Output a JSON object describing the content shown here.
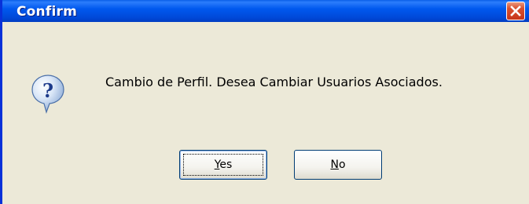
{
  "window": {
    "title": "Confirm"
  },
  "dialog": {
    "icon": "question-icon",
    "message": "Cambio de Perfil. Desea Cambiar Usuarios Asociados."
  },
  "buttons": {
    "yes_accel": "Y",
    "yes_rest": "es",
    "no_accel": "N",
    "no_rest": "o"
  },
  "colors": {
    "titlebar": "#0058ee",
    "close": "#c7361b",
    "dialog_bg": "#ece9d8"
  }
}
